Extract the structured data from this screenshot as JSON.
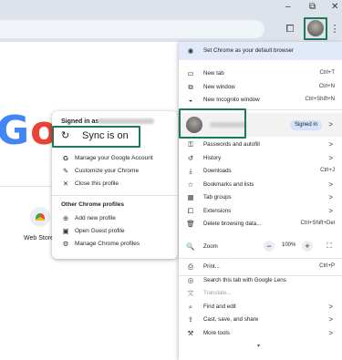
{
  "window": {
    "minimize": "–",
    "maximize": "⧉",
    "close": "✕"
  },
  "toolbar": {
    "extensions_icon": "puzzle-icon",
    "more_icon": "kebab-icon"
  },
  "page": {
    "logo_letters": [
      {
        "ch": "G",
        "color": "#4285f4"
      },
      {
        "ch": "o",
        "color": "#ea4335"
      },
      {
        "ch": "o",
        "color": "#fbbc04"
      }
    ],
    "shortcut_label": "Web Store"
  },
  "profile_popup": {
    "signed_in_as": "Signed in as",
    "sync": "Sync is on",
    "items": [
      {
        "label": "Manage your Google Account",
        "icon": "G"
      },
      {
        "label": "Customize your Chrome",
        "icon": "✎"
      },
      {
        "label": "Close this profile",
        "icon": "✕"
      }
    ],
    "other_heading": "Other Chrome profiles",
    "other_items": [
      {
        "label": "Add new profile",
        "icon": "⊕"
      },
      {
        "label": "Open Guest profile",
        "icon": "▣"
      },
      {
        "label": "Manage Chrome profiles",
        "icon": "⚙"
      }
    ]
  },
  "menu": {
    "banner": "Set Chrome as your default browser",
    "group1": [
      {
        "label": "New tab",
        "shortcut": "Ctrl+T",
        "icon": "▭"
      },
      {
        "label": "New window",
        "shortcut": "Ctrl+N",
        "icon": "⧉"
      },
      {
        "label": "New Incognito window",
        "shortcut": "Ctrl+Shift+N",
        "icon": "◒"
      }
    ],
    "profile": {
      "badge": "Signed in",
      "arrow": ">"
    },
    "group2": [
      {
        "label": "Passwords and autofill",
        "shortcut": ">",
        "icon": "⚿"
      },
      {
        "label": "History",
        "shortcut": ">",
        "icon": "↺"
      },
      {
        "label": "Downloads",
        "shortcut": "Ctrl+J",
        "icon": "⤓"
      },
      {
        "label": "Bookmarks and lists",
        "shortcut": ">",
        "icon": "☆"
      },
      {
        "label": "Tab groups",
        "shortcut": ">",
        "icon": "▦"
      },
      {
        "label": "Extensions",
        "shortcut": ">",
        "icon": "⧠"
      },
      {
        "label": "Delete browsing data...",
        "shortcut": "Ctrl+Shift+Del",
        "icon": "🗑"
      }
    ],
    "zoom": {
      "label": "Zoom",
      "minus": "−",
      "value": "100%",
      "plus": "+",
      "fullscreen": "⛶"
    },
    "group3": [
      {
        "label": "Print...",
        "shortcut": "Ctrl+P",
        "icon": "⎙",
        "disabled": false
      },
      {
        "label": "Search this tab with Google Lens",
        "shortcut": "",
        "icon": "◎",
        "disabled": false
      },
      {
        "label": "Translate...",
        "shortcut": "",
        "icon": "文",
        "disabled": true
      },
      {
        "label": "Find and edit",
        "shortcut": ">",
        "icon": "⌕",
        "disabled": false
      },
      {
        "label": "Cast, save, and share",
        "shortcut": ">",
        "icon": "⇪",
        "disabled": false
      },
      {
        "label": "More tools",
        "shortcut": ">",
        "icon": "⚒",
        "disabled": false
      }
    ],
    "scroll_indicator": "▾"
  },
  "colors": {
    "highlight": "#1e7a56",
    "banner": "#e2e9f8",
    "signed_badge": "#d3e3fd"
  }
}
